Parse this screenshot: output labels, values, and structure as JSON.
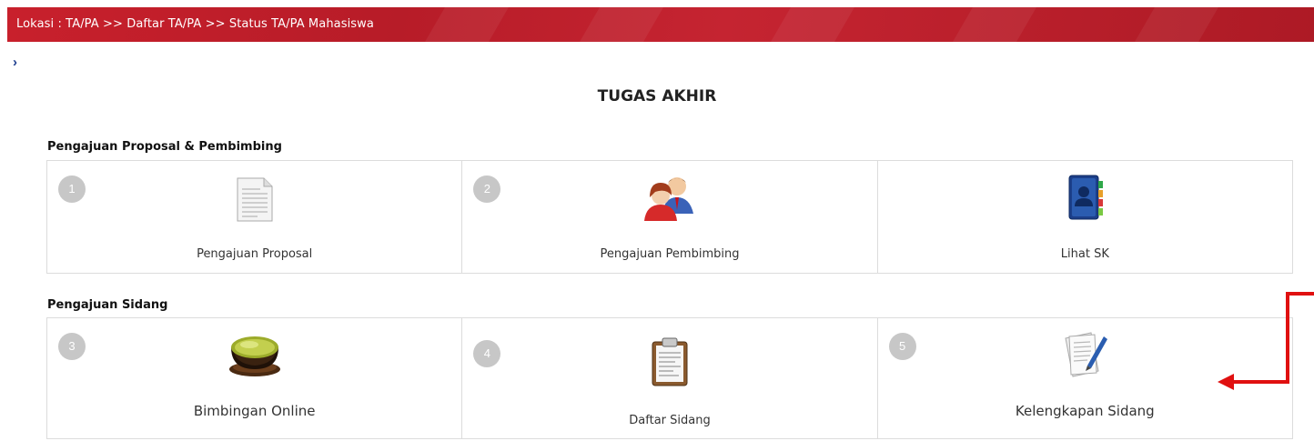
{
  "breadcrumb": {
    "text": "Lokasi : TA/PA >> Daftar TA/PA >> Status TA/PA Mahasiswa"
  },
  "nav": {
    "chevron": "›"
  },
  "page": {
    "title": "TUGAS AKHIR"
  },
  "sections": [
    {
      "label": "Pengajuan Proposal & Pembimbing",
      "items": [
        {
          "number": "1",
          "label": "Pengajuan Proposal",
          "icon": "document-icon"
        },
        {
          "number": "2",
          "label": "Pengajuan Pembimbing",
          "icon": "users-icon"
        },
        {
          "number": "",
          "label": "Lihat SK",
          "icon": "address-book-icon"
        }
      ]
    },
    {
      "label": "Pengajuan Sidang",
      "items": [
        {
          "number": "3",
          "label": "Bimbingan Online",
          "icon": "tea-cup-icon"
        },
        {
          "number": "4",
          "label": "Daftar Sidang",
          "icon": "clipboard-icon"
        },
        {
          "number": "5",
          "label": "Kelengkapan Sidang",
          "icon": "document-pen-icon"
        }
      ]
    }
  ],
  "colors": {
    "header": "#c0202b",
    "badge": "#c7c7c7",
    "annotation": "#e01010",
    "border": "#dcdcdc"
  }
}
